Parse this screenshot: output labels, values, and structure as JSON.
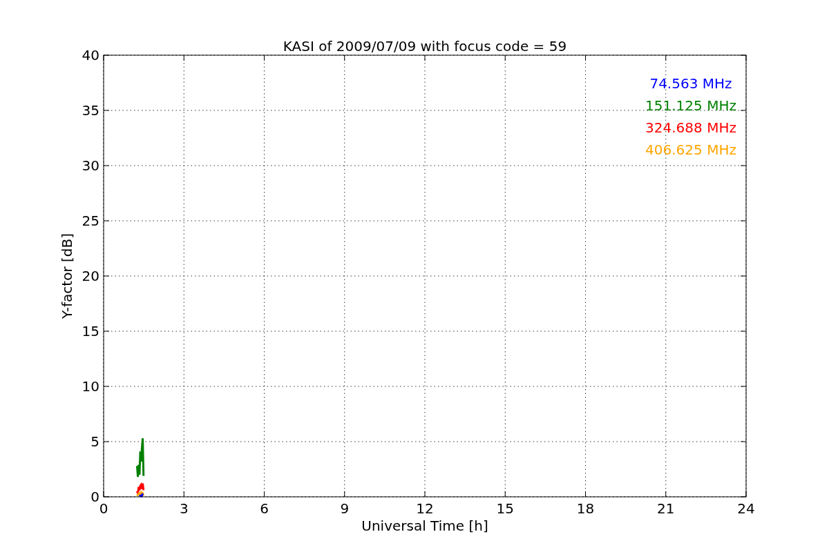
{
  "chart_data": {
    "type": "line",
    "title": "KASI of 2009/07/09 with focus code = 59",
    "xlabel": "Universal Time [h]",
    "ylabel": "Y-factor [dB]",
    "x": [
      1.25,
      1.28,
      1.31,
      1.34,
      1.37,
      1.4,
      1.43,
      1.46,
      1.49
    ],
    "series": [
      {
        "name": "74.563 MHz",
        "color": "#0000ff",
        "values": [
          null,
          null,
          null,
          0.05,
          0.1,
          0.05,
          0.1,
          0.3,
          null
        ]
      },
      {
        "name": "151.125 MHz",
        "color": "#008000",
        "values": [
          2.8,
          1.8,
          2.9,
          2.0,
          4.1,
          3.2,
          4.4,
          5.3,
          1.9
        ]
      },
      {
        "name": "324.688 MHz",
        "color": "#ff0000",
        "values": [
          0.5,
          0.3,
          0.9,
          0.6,
          1.0,
          1.1,
          0.7,
          1.2,
          0.6
        ]
      },
      {
        "name": "406.625 MHz",
        "color": "#ffa500",
        "values": [
          0.1,
          0.2,
          0.3,
          0.2,
          0.3,
          0.4,
          0.2,
          0.3,
          0.1
        ]
      }
    ],
    "xlim": [
      0,
      24
    ],
    "ylim": [
      0,
      40
    ],
    "xticks": [
      0,
      3,
      6,
      9,
      12,
      15,
      18,
      21,
      24
    ],
    "yticks": [
      0,
      5,
      10,
      15,
      20,
      25,
      30,
      35,
      40
    ],
    "grid": true
  }
}
